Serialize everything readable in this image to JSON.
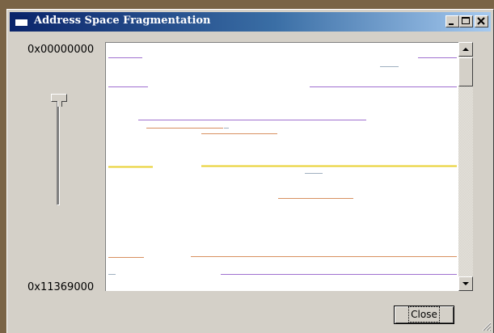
{
  "window": {
    "title": "Address Space Fragmentation"
  },
  "titlebar_buttons": {
    "minimize_icon": "minimize-icon",
    "maximize_icon": "maximize-icon",
    "close_icon": "close-icon"
  },
  "address_range": {
    "start": "0x00000000",
    "end": "0x11369000"
  },
  "zoom_slider": {
    "position": 0.05
  },
  "scrollbar": {
    "position": 0.0
  },
  "close_button": {
    "label": "Close"
  },
  "colors": {
    "purple": "#a070d0",
    "orange": "#d89060",
    "yellow": "#e8d030",
    "gray_blue": "#a0b0c0"
  }
}
